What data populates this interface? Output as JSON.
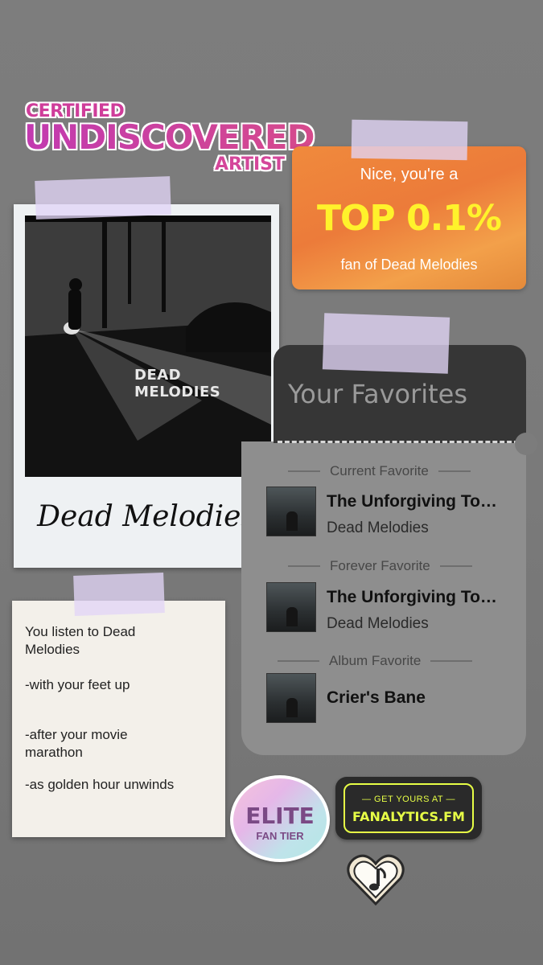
{
  "certified": {
    "line1": "CERTIFIED",
    "line2": "UNDISCOVERED",
    "line3": "ARTIST"
  },
  "top_card": {
    "line1": "Nice, you're a",
    "highlight": "TOP 0.1%",
    "line3": "fan of Dead Melodies",
    "highlight_color": "#fff22b"
  },
  "polaroid": {
    "photo_text": "DEAD MELODIES",
    "caption": "Dead Melodies"
  },
  "favorites": {
    "title": "Your Favorites",
    "sections": [
      {
        "label": "Current Favorite",
        "title": "The Unforgiving To…",
        "artist": "Dead Melodies"
      },
      {
        "label": "Forever Favorite",
        "title": "The Unforgiving To…",
        "artist": "Dead Melodies"
      },
      {
        "label": "Album Favorite",
        "title": "Crier's Bane",
        "artist": ""
      }
    ]
  },
  "note": {
    "line1": "You listen to Dead Melodies",
    "line2": "-with your feet up",
    "line3": "-after your movie marathon",
    "line4": "-as golden hour unwinds"
  },
  "badge": {
    "title": "ELITE",
    "subtitle": "FAN TIER"
  },
  "cta": {
    "small": "— GET YOURS AT —",
    "big": "FANALYTICS.FM",
    "accent": "#e7ff46"
  },
  "icons": {
    "heart_pin": "music-note-heart-icon"
  }
}
